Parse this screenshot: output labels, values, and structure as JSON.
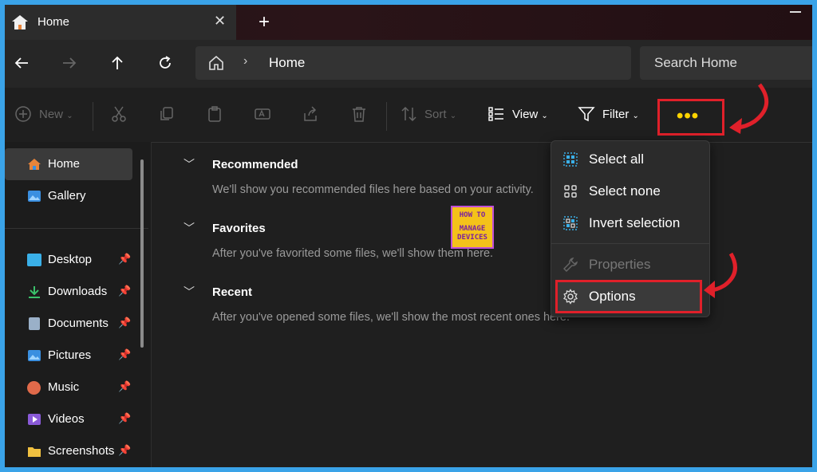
{
  "window": {
    "tab_title": "Home",
    "tab_close": "✕",
    "new_tab": "+"
  },
  "addressbar": {
    "location": "Home",
    "search_placeholder": "Search Home"
  },
  "toolbar": {
    "new_label": "New",
    "sort_label": "Sort",
    "view_label": "View",
    "filter_label": "Filter",
    "more_label": "•••"
  },
  "sidebar": {
    "items": [
      {
        "label": "Home",
        "icon": "home-icon",
        "color": "#e8843a"
      },
      {
        "label": "Gallery",
        "icon": "gallery-icon",
        "color": "#3a8fe0"
      },
      {
        "label": "Desktop",
        "icon": "desktop-icon",
        "color": "#3ab0e8",
        "pinned": true
      },
      {
        "label": "Downloads",
        "icon": "download-icon",
        "color": "#3ac06a",
        "pinned": true
      },
      {
        "label": "Documents",
        "icon": "documents-icon",
        "color": "#9ab0c8",
        "pinned": true
      },
      {
        "label": "Pictures",
        "icon": "pictures-icon",
        "color": "#3a8fe0",
        "pinned": true
      },
      {
        "label": "Music",
        "icon": "music-icon",
        "color": "#e06a4a",
        "pinned": true
      },
      {
        "label": "Videos",
        "icon": "videos-icon",
        "color": "#8a5ad8",
        "pinned": true
      },
      {
        "label": "Screenshots",
        "icon": "folder-icon",
        "color": "#f0c040",
        "pinned": true
      }
    ]
  },
  "main": {
    "sections": [
      {
        "title": "Recommended",
        "description": "We'll show you recommended files here based on your activity."
      },
      {
        "title": "Favorites",
        "description": "After you've favorited some files, we'll show them here."
      },
      {
        "title": "Recent",
        "description": "After you've opened some files, we'll show the most recent ones here."
      }
    ]
  },
  "logo": {
    "line1": "HOW TO",
    "line2": "MANAGE",
    "line3": "DEVICES"
  },
  "menu": {
    "items": [
      {
        "label": "Select all",
        "enabled": true
      },
      {
        "label": "Select none",
        "enabled": true
      },
      {
        "label": "Invert selection",
        "enabled": true
      },
      {
        "label": "Properties",
        "enabled": false
      },
      {
        "label": "Options",
        "enabled": true
      }
    ]
  },
  "colors": {
    "highlight_box": "#e0202a",
    "accent_dots": "#ffd400"
  }
}
